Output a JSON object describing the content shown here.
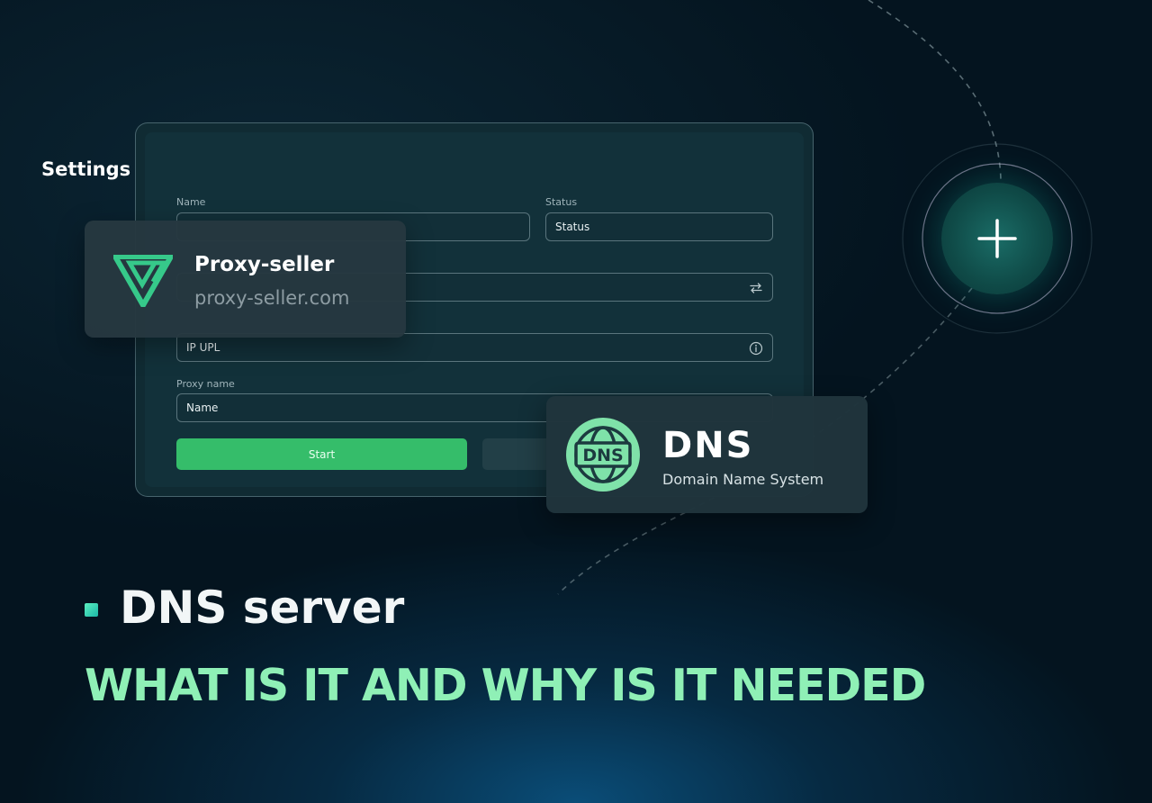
{
  "settings": {
    "title": "Settings",
    "name_label": "Name",
    "status_label": "Status",
    "status_value": "Status",
    "ip_value": "IP UPL",
    "proxy_name_label": "Proxy name",
    "proxy_name_value": "Name",
    "start_label": "Start"
  },
  "brand_card": {
    "name": "Proxy-seller",
    "url": "proxy-seller.com"
  },
  "dns_card": {
    "badge": "DNS",
    "title": "DNS",
    "subtitle": "Domain Name System"
  },
  "headline": {
    "title": "DNS server",
    "subtitle": "WHAT IS IT AND WHY IS IT NEEDED"
  },
  "colors": {
    "accent_green": "#35bd6a",
    "subtitle_green": "#8ff0b6",
    "background": "#04141f"
  },
  "icons": {
    "swap": "swap-arrows-icon",
    "info": "info-icon",
    "plus": "plus-icon",
    "globe": "globe-icon",
    "logo": "proxy-seller-logo-icon"
  }
}
